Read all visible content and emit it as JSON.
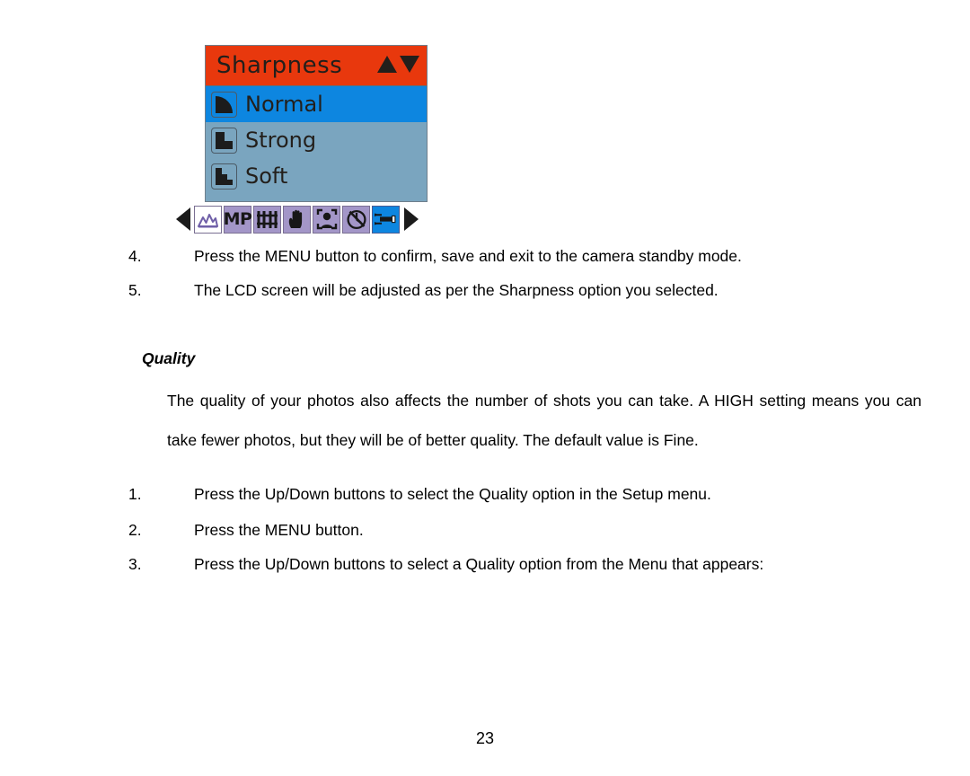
{
  "document": {
    "page_number": "23",
    "section_heading": "Quality",
    "paragraph": "The quality of your photos also affects the number of shots you can take. A HIGH setting means you can take fewer photos, but they will be of better quality. The default value is Fine.",
    "steps_top": [
      {
        "number": "4.",
        "text": "Press the MENU button to confirm, save and exit to the camera standby mode."
      },
      {
        "number": "5.",
        "text": "The LCD screen will be adjusted as per the Sharpness option you selected."
      }
    ],
    "steps_bottom": [
      {
        "number": "1.",
        "text": "Press the Up/Down buttons to select the Quality option in the Setup menu."
      },
      {
        "number": "2.",
        "text": "Press the MENU button."
      },
      {
        "number": "3.",
        "text": "Press the Up/Down buttons to select a Quality option from the Menu that appears:"
      }
    ]
  },
  "lcd_menu": {
    "title": "Sharpness",
    "header_color": "#e8380d",
    "selected_color": "#0d86e0",
    "list_background_color": "#7aa5bf",
    "up_arrow_icon": "triangle-up-icon",
    "down_arrow_icon": "triangle-down-icon",
    "options": [
      {
        "label": "Normal",
        "icon": "sharpness-normal-icon",
        "selected": true
      },
      {
        "label": "Strong",
        "icon": "sharpness-strong-icon",
        "selected": false
      },
      {
        "label": "Soft",
        "icon": "sharpness-soft-icon",
        "selected": false
      }
    ],
    "mode_strip": {
      "prev_arrow_icon": "arrow-left-icon",
      "next_arrow_icon": "arrow-right-icon",
      "items": [
        {
          "icon": "scene-mountain-icon",
          "label": "",
          "style": "white",
          "active": false
        },
        {
          "icon": "megapixel-icon",
          "label": "MP",
          "style": "purple",
          "active": false
        },
        {
          "icon": "sharpness-bars-icon",
          "label": "",
          "style": "purple",
          "active": false
        },
        {
          "icon": "hand-stabilizer-icon",
          "label": "",
          "style": "purple",
          "active": false
        },
        {
          "icon": "face-detection-icon",
          "label": "",
          "style": "purple",
          "active": false
        },
        {
          "icon": "self-timer-off-icon",
          "label": "",
          "style": "purple",
          "active": false
        },
        {
          "icon": "wrench-setup-icon",
          "label": "",
          "style": "active",
          "active": true
        }
      ]
    }
  }
}
